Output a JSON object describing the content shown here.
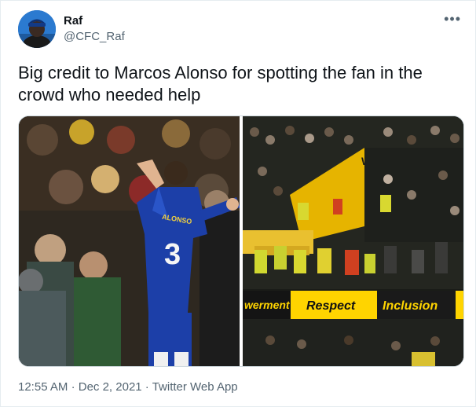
{
  "tweet": {
    "author": {
      "display_name": "Raf",
      "handle": "@CFC_Raf",
      "avatar_icon": "profile-avatar"
    },
    "more_icon": "more-options-icon",
    "more_glyph": "•••",
    "text": "Big credit to Marcos Alonso for spotting the fan in the crowd who needed help",
    "media": {
      "left_photo": {
        "jersey_name": "ALONSO",
        "jersey_number": "3"
      },
      "right_photo": {
        "board_partial": "werment",
        "board_respect": "Respect",
        "board_inclusion": "Inclusion",
        "top_sign_partial": "W"
      }
    },
    "time": "12:55 AM",
    "separator": "·",
    "date": "Dec 2, 2021",
    "source": "Twitter Web App"
  },
  "colors": {
    "chelsea_blue": "#1c3fa8",
    "stand_yellow": "#f2c230",
    "board_yellow": "#ffd400",
    "text_primary": "#0f1419",
    "text_secondary": "#536471"
  }
}
